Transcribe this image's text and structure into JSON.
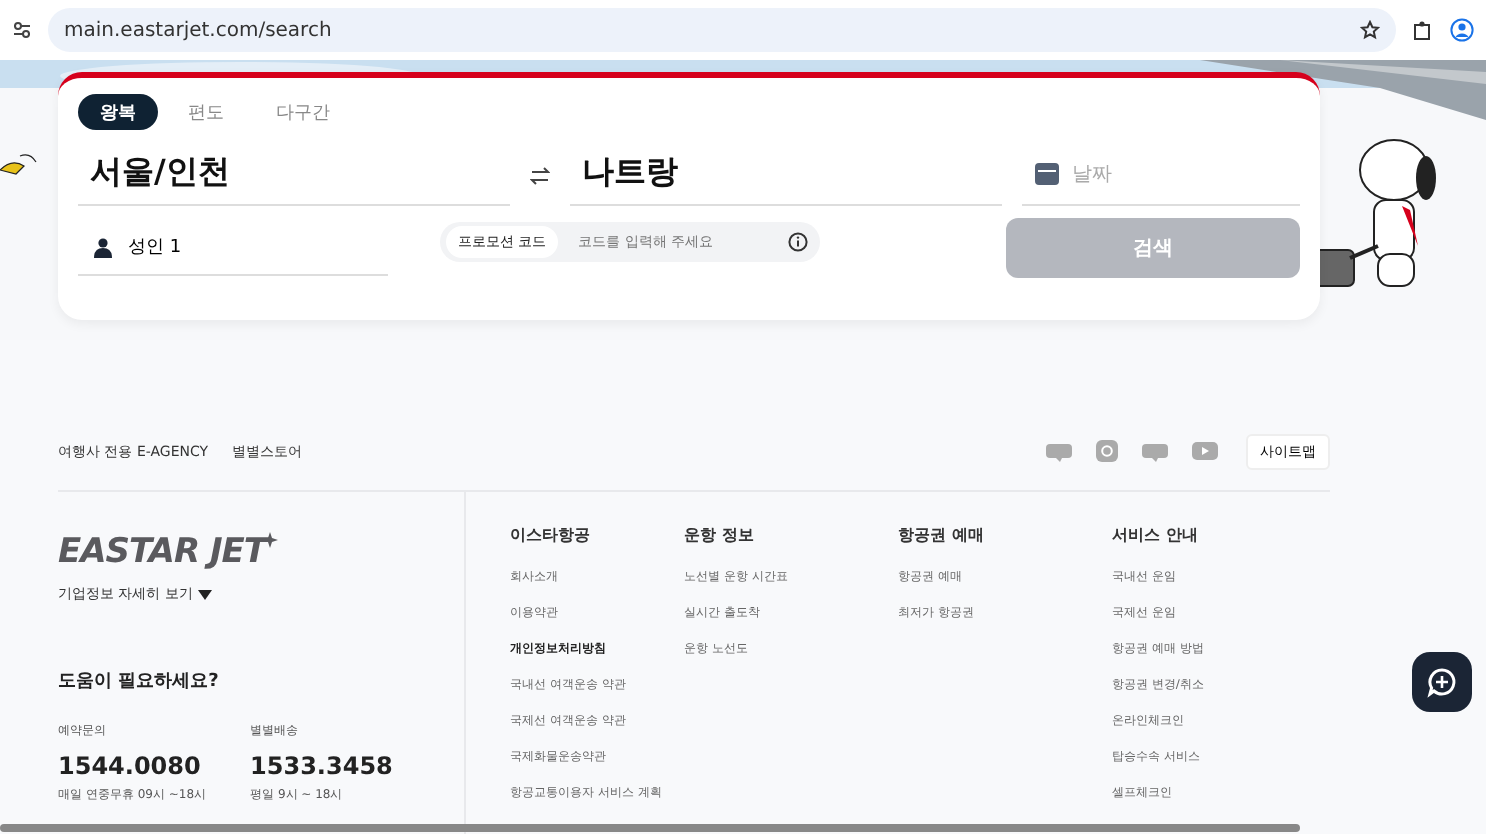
{
  "browser": {
    "url": "main.eastarjet.com/search"
  },
  "search": {
    "tabs": [
      {
        "label": "왕복",
        "selected": true
      },
      {
        "label": "편도",
        "selected": false
      },
      {
        "label": "다구간",
        "selected": false
      }
    ],
    "origin": "서울/인천",
    "destination": "나트랑",
    "date_placeholder": "날짜",
    "passengers": "성인 1",
    "promo": {
      "label": "프로모션 코드",
      "placeholder": "코드를 입력해 주세요"
    },
    "search_button": {
      "label": "검색",
      "disabled": true
    }
  },
  "footer": {
    "top_links": [
      "여행사 전용 E-AGENCY",
      "별별스토어"
    ],
    "sitemap_button": "사이트맵",
    "logo": "EASTAR JET",
    "info_toggle": "기업정보 자세히 보기",
    "help": {
      "title": "도움이 필요하세요?",
      "contacts": [
        {
          "label": "예약문의",
          "number": "1544.0080",
          "hours": "매일 연중무휴 09시 ~18시"
        },
        {
          "label": "별별배송",
          "number": "1533.3458",
          "hours": "평일 9시 ~ 18시"
        }
      ]
    },
    "columns": [
      {
        "title": "이스타항공",
        "items": [
          {
            "label": "회사소개",
            "emphasized": false
          },
          {
            "label": "이용약관",
            "emphasized": false
          },
          {
            "label": "개인정보처리방침",
            "emphasized": true
          },
          {
            "label": "국내선 여객운송 약관",
            "emphasized": false
          },
          {
            "label": "국제선 여객운송 약관",
            "emphasized": false
          },
          {
            "label": "국제화물운송약관",
            "emphasized": false
          },
          {
            "label": "항공교통이용자 서비스 계획",
            "emphasized": false
          }
        ]
      },
      {
        "title": "운항 정보",
        "items": [
          {
            "label": "노선별 운항 시간표",
            "emphasized": false
          },
          {
            "label": "실시간 출도착",
            "emphasized": false
          },
          {
            "label": "운항 노선도",
            "emphasized": false
          }
        ]
      },
      {
        "title": "항공권 예매",
        "items": [
          {
            "label": "항공권 예매",
            "emphasized": false
          },
          {
            "label": "최저가 항공권",
            "emphasized": false
          }
        ]
      },
      {
        "title": "서비스 안내",
        "items": [
          {
            "label": "국내선 운임",
            "emphasized": false
          },
          {
            "label": "국제선 운임",
            "emphasized": false
          },
          {
            "label": "항공권 예매 방법",
            "emphasized": false
          },
          {
            "label": "항공권 변경/취소",
            "emphasized": false
          },
          {
            "label": "온라인체크인",
            "emphasized": false
          },
          {
            "label": "탑승수속 서비스",
            "emphasized": false
          },
          {
            "label": "셀프체크인",
            "emphasized": false
          }
        ]
      }
    ]
  }
}
